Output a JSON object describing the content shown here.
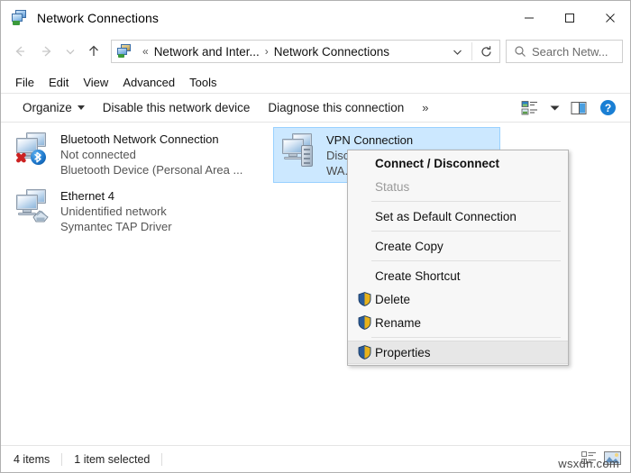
{
  "window": {
    "title": "Network Connections",
    "icon": "network-connections-icon",
    "controls": {
      "minimize": "—",
      "maximize": "□",
      "close": "✕"
    }
  },
  "address_bar": {
    "back": "back-arrow",
    "forward": "forward-arrow",
    "recent": "recent-locations-chevron",
    "up": "up-arrow",
    "breadcrumb": {
      "overflow": "«",
      "parent": "Network and Inter...",
      "separator": "›",
      "current": "Network Connections"
    },
    "dropdown": "chevron-down",
    "refresh": "refresh-icon"
  },
  "search": {
    "placeholder": "Search Netw...",
    "icon": "search-icon"
  },
  "menu_bar": {
    "items": [
      {
        "label": "File"
      },
      {
        "label": "Edit"
      },
      {
        "label": "View"
      },
      {
        "label": "Advanced"
      },
      {
        "label": "Tools"
      }
    ]
  },
  "command_bar": {
    "organize": "Organize",
    "disable_device": "Disable this network device",
    "diagnose": "Diagnose this connection",
    "overflow": "»",
    "view_options": "view-options-icon",
    "view_dropdown": "view-dropdown-caret",
    "preview_pane": "preview-pane-icon",
    "help": "help-icon"
  },
  "connections": [
    {
      "name": "Bluetooth Network Connection",
      "status": "Not connected",
      "device": "Bluetooth Device (Personal Area ...",
      "icon": "bluetooth-network-icon",
      "badge": "red-x-badge",
      "selected": false
    },
    {
      "name": "Ethernet 4",
      "status": "Unidentified network",
      "device": "Symantec TAP Driver",
      "icon": "ethernet-network-icon",
      "badge": "rj45-badge",
      "selected": false
    },
    {
      "name": "VPN Connection",
      "status": "Disc...",
      "device": "WA...",
      "icon": "vpn-network-icon",
      "badge": "server-badge",
      "selected": true
    }
  ],
  "context_menu": {
    "items": [
      {
        "label": "Connect / Disconnect",
        "bold": true,
        "disabled": false,
        "shield": false,
        "highlighted": false,
        "separator_after": false
      },
      {
        "label": "Status",
        "bold": false,
        "disabled": true,
        "shield": false,
        "highlighted": false,
        "separator_after": true
      },
      {
        "label": "Set as Default Connection",
        "bold": false,
        "disabled": false,
        "shield": false,
        "highlighted": false,
        "separator_after": true
      },
      {
        "label": "Create Copy",
        "bold": false,
        "disabled": false,
        "shield": false,
        "highlighted": false,
        "separator_after": true
      },
      {
        "label": "Create Shortcut",
        "bold": false,
        "disabled": false,
        "shield": false,
        "highlighted": false,
        "separator_after": false
      },
      {
        "label": "Delete",
        "bold": false,
        "disabled": false,
        "shield": true,
        "highlighted": false,
        "separator_after": false
      },
      {
        "label": "Rename",
        "bold": false,
        "disabled": false,
        "shield": true,
        "highlighted": false,
        "separator_after": true
      },
      {
        "label": "Properties",
        "bold": false,
        "disabled": false,
        "shield": true,
        "highlighted": true,
        "separator_after": false
      }
    ]
  },
  "status_bar": {
    "item_count": "4 items",
    "selection": "1 item selected",
    "details_view_icon": "details-view-icon",
    "large_icons_view_icon": "large-icons-view-icon"
  },
  "watermark": {
    "text": "wsxdn.com"
  },
  "colors": {
    "selection_fill": "#cce8ff",
    "selection_border": "#99d1ff",
    "menu_highlight": "#e7e7e7",
    "accent_blue": "#0078d7",
    "shield_blue": "#2a5c9b",
    "shield_gold": "#e8b21a"
  }
}
